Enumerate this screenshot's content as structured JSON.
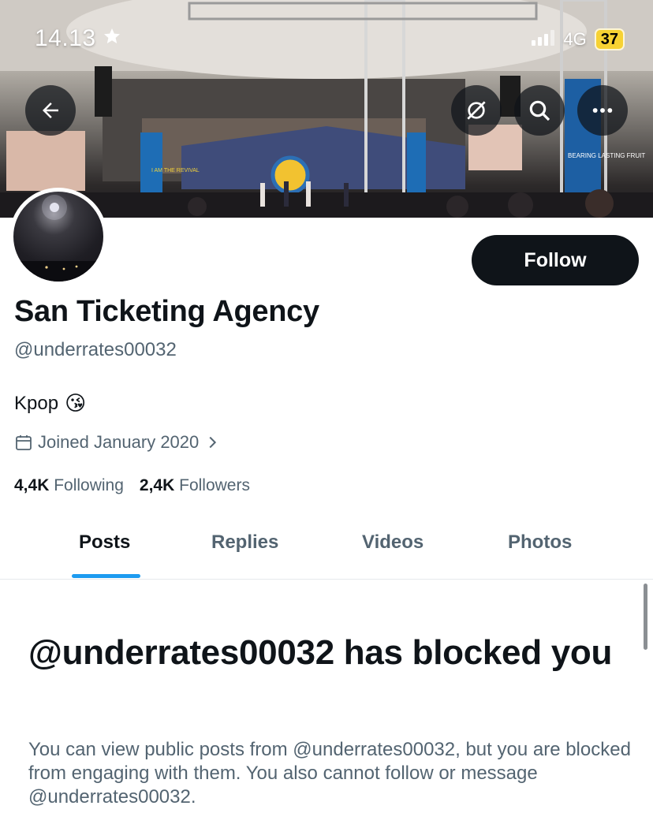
{
  "status_bar": {
    "time": "14.13",
    "network": "4G",
    "battery": "37"
  },
  "profile": {
    "display_name": "San Ticketing Agency",
    "handle": "@underrates00032",
    "bio_text": "Kpop",
    "bio_emoji": "😘",
    "joined": "Joined January 2020",
    "following_count": "4,4K",
    "following_label": "Following",
    "followers_count": "2,4K",
    "followers_label": "Followers"
  },
  "actions": {
    "follow_label": "Follow"
  },
  "tabs": [
    {
      "label": "Posts",
      "active": true
    },
    {
      "label": "Replies",
      "active": false
    },
    {
      "label": "Videos",
      "active": false
    },
    {
      "label": "Photos",
      "active": false
    }
  ],
  "blocked": {
    "title": "@underrates00032 has blocked you",
    "description": "You can view public posts from @underrates00032, but you are blocked from engaging with them. You also cannot follow or message @underrates00032."
  },
  "banner": {
    "sign_left": "I AM THE REVIVAL",
    "sign_right": "BEARING LASTING FRUIT"
  },
  "colors": {
    "accent": "#1d9bf0",
    "primary_text": "#0f1419",
    "secondary_text": "#536471",
    "battery": "#f7d233"
  },
  "icons": [
    "back-arrow-icon",
    "sync-off-icon",
    "search-icon",
    "more-icon",
    "calendar-icon",
    "chevron-right-icon",
    "star-icon",
    "signal-icon"
  ]
}
